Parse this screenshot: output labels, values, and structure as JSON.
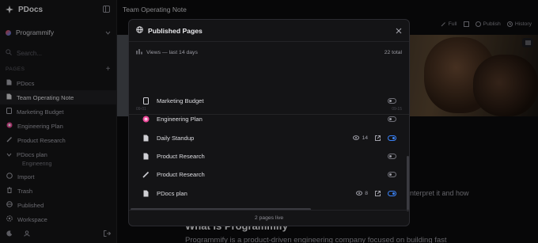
{
  "app": {
    "name": "PDocs"
  },
  "sidebar": {
    "workspace": "Programmify",
    "search_placeholder": "Search...",
    "pages_header": "PAGES",
    "pages": [
      {
        "label": "PDocs",
        "icon": "page-icon"
      },
      {
        "label": "Team Operating Note",
        "icon": "page-icon",
        "active": true
      },
      {
        "label": "Marketing Budget",
        "icon": "page-icon"
      },
      {
        "label": "Engineering Plan",
        "icon": "target-icon"
      },
      {
        "label": "Product Research",
        "icon": "pen-icon"
      },
      {
        "label": "PDocs plan",
        "icon": "chevron-down-icon"
      }
    ],
    "sub_item": "Engineering",
    "nav": [
      {
        "label": "Import",
        "icon": "import-icon"
      },
      {
        "label": "Trash",
        "icon": "trash-icon"
      },
      {
        "label": "Published",
        "icon": "globe-icon"
      },
      {
        "label": "Workspace",
        "icon": "gear-icon"
      }
    ]
  },
  "main": {
    "title": "Team Operating Note",
    "toolbar": {
      "full": "Full",
      "publish": "Publish",
      "history": "History"
    },
    "body_fragment_1": "nterpret it and how",
    "body_heading": "What is Programmify",
    "body_fragment_2": "Programmify is a product-driven engineering company focused on building fast"
  },
  "modal": {
    "title": "Published Pages",
    "views_label": "Views — last 14 days",
    "views_total": "22 total",
    "axis_left": "09-01",
    "axis_right": "09-15",
    "items": [
      {
        "name": "Marketing Budget",
        "icon": "page-icon",
        "views": "",
        "published": false
      },
      {
        "name": "Engineering Plan",
        "icon": "target-icon",
        "views": "",
        "published": false
      },
      {
        "name": "Daily Standup",
        "icon": "file-icon",
        "views": "14",
        "published": true
      },
      {
        "name": "Product Research",
        "icon": "file-icon",
        "views": "",
        "published": false
      },
      {
        "name": "Product Research",
        "icon": "pen-icon",
        "views": "",
        "published": false
      },
      {
        "name": "PDocs plan",
        "icon": "file-icon",
        "views": "8",
        "published": true
      }
    ],
    "footer": "2 pages live"
  },
  "colors": {
    "accent": "#3b82f6",
    "background": "#0c0c0d",
    "panel": "#141416"
  }
}
